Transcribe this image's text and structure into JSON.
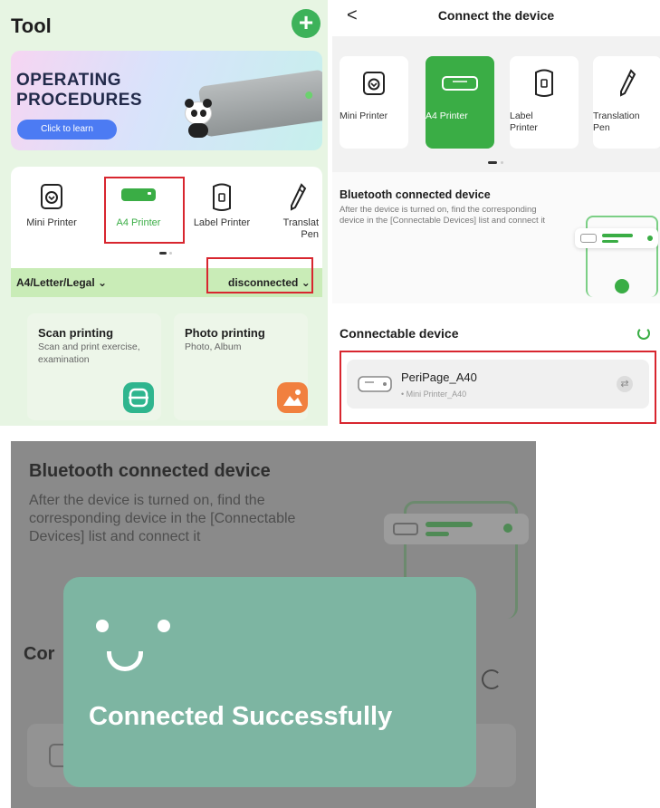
{
  "tool": {
    "title": "Tool",
    "add_icon": "plus-icon",
    "banner": {
      "title": "OPERATING PROCEDURES",
      "button": "Click to learn"
    },
    "devices": [
      {
        "label": "Mini Printer",
        "icon": "mini-printer-icon"
      },
      {
        "label": "A4 Printer",
        "icon": "a4-printer-icon",
        "selected": true
      },
      {
        "label": "Label Printer",
        "icon": "label-printer-icon"
      },
      {
        "label": "Translat\nPen",
        "icon": "translation-pen-icon"
      }
    ],
    "paper_size": "A4/Letter/Legal",
    "status": "disconnected",
    "functions": [
      {
        "title": "Scan printing",
        "subtitle": "Scan and print exercise, examination",
        "icon": "scan-icon"
      },
      {
        "title": "Photo printing",
        "subtitle": "Photo, Album",
        "icon": "photo-icon"
      }
    ],
    "colors": {
      "accent": "#3db25a",
      "highlight": "#d8262f",
      "banner_button": "#4c7bf3"
    }
  },
  "connect": {
    "back": "<",
    "title": "Connect the device",
    "devices": [
      {
        "label": "Mini Printer"
      },
      {
        "label": "A4 Printer",
        "selected": true
      },
      {
        "label": "Label\nPrinter"
      },
      {
        "label": "Translation\nPen"
      }
    ],
    "bluetooth": {
      "title": "Bluetooth connected device",
      "description": "After the device is turned on, find the corresponding device in the [Connectable Devices] list and connect it"
    },
    "connectable_title": "Connectable device",
    "device": {
      "name": "PeriPage_A40",
      "model": "• Mini Printer_A40"
    },
    "colors": {
      "active": "#3aad45"
    }
  },
  "success": {
    "bg_title": "Bluetooth connected device",
    "bg_desc": "After the device is turned on, find the corresponding device in the [Connectable Devices] list and connect it",
    "bg_connectable": "Cor",
    "message": "Connected Successfully",
    "colors": {
      "toast": "#7db5a2"
    }
  }
}
